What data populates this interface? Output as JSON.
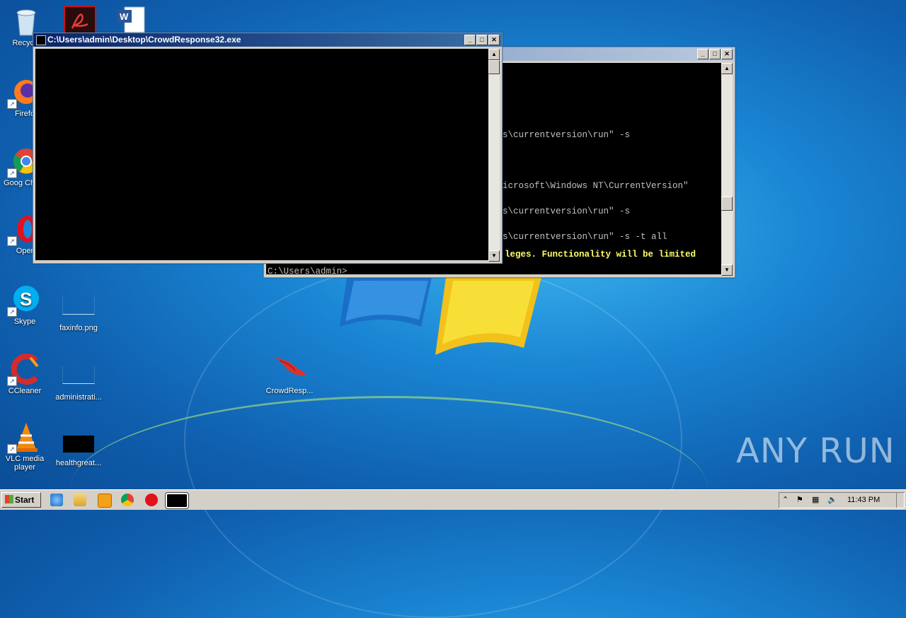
{
  "desktop": {
    "icons": [
      {
        "label": "Recycle"
      },
      {
        "label": "Firefo"
      },
      {
        "label": "Goog Chron"
      },
      {
        "label": "Oper"
      },
      {
        "label": "Skype"
      },
      {
        "label": "CCleaner"
      },
      {
        "label": "VLC media player"
      },
      {
        "label": "faxinfo.png"
      },
      {
        "label": "administrati..."
      },
      {
        "label": "healthgreat..."
      },
      {
        "label": "CrowdResp..."
      }
    ]
  },
  "window_front": {
    "title": "C:\\Users\\admin\\Desktop\\CrowdResponse32.exe"
  },
  "window_back": {
    "lines": [
      "s\\currentversion\\run\" -s",
      "",
      "icrosoft\\Windows NT\\CurrentVersion\"",
      "s\\currentversion\\run\" -s",
      "s\\currentversion\\run\" -s -t all"
    ],
    "warning": "leges. Functionality will be limited",
    "prompt": "C:\\Users\\admin>"
  },
  "taskbar": {
    "start_label": "Start",
    "clock": "11:43 PM"
  },
  "watermark": "ANY RUN",
  "colors": {
    "console_bg": "#000000",
    "console_fg": "#c0c0c0",
    "warning_fg": "#ffff66",
    "title_active": "#0a246a"
  }
}
